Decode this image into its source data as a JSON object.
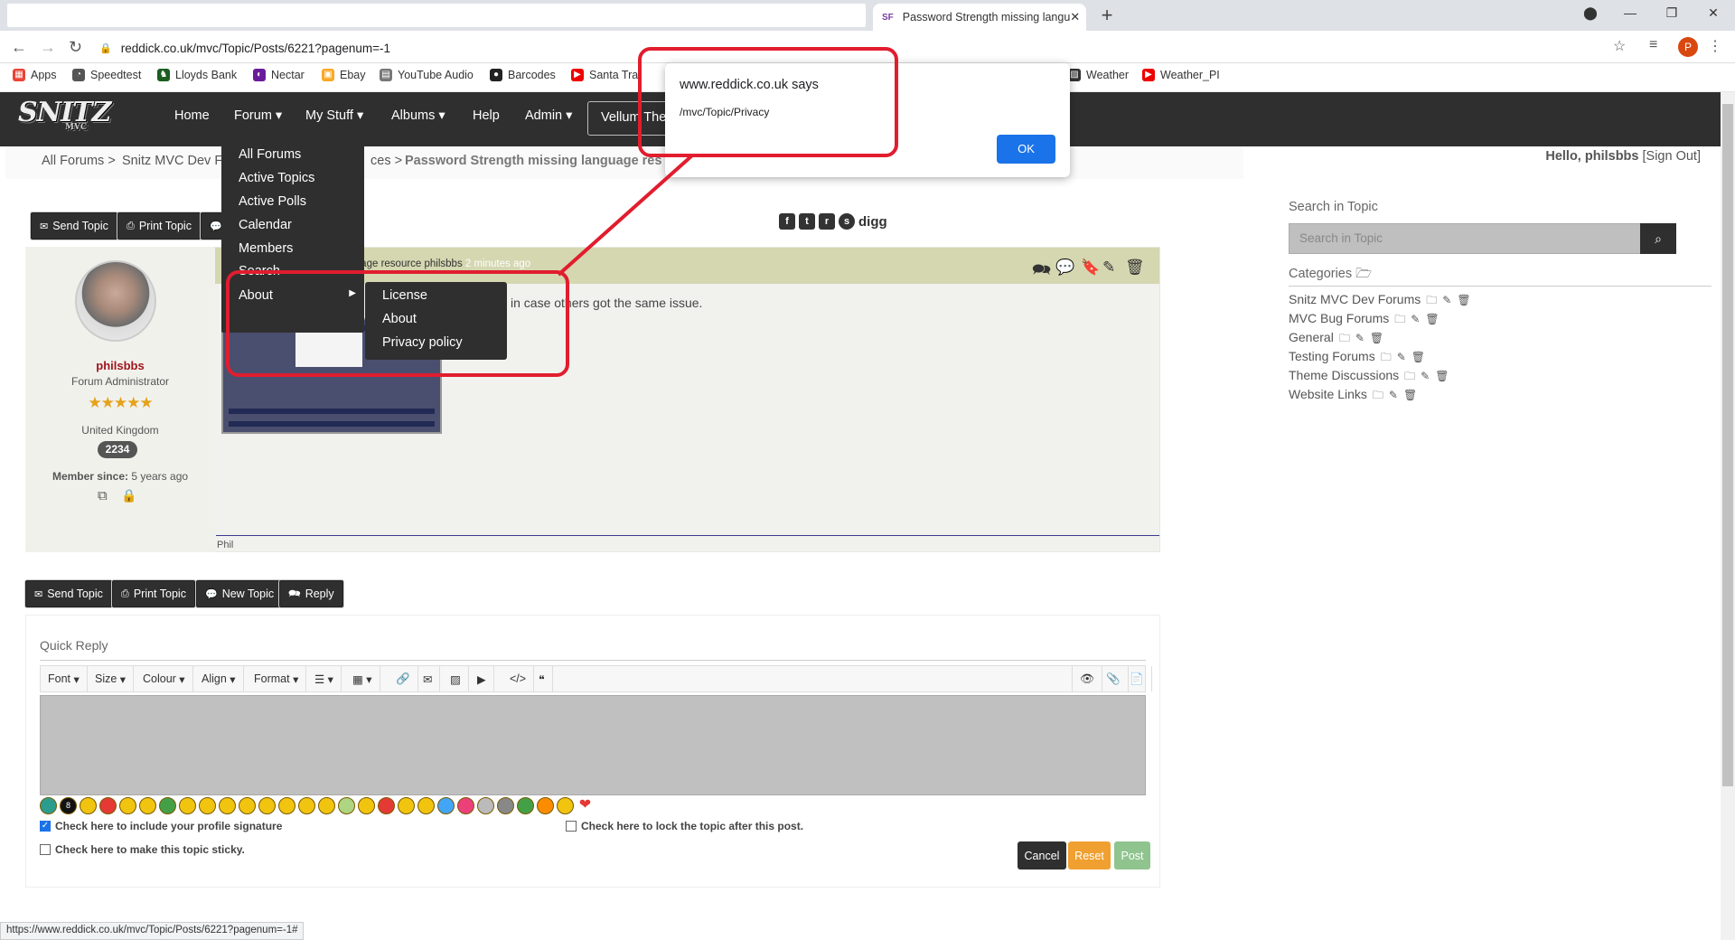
{
  "browser": {
    "tab_title": "Password Strength missing langu",
    "tab_favicon": "SF",
    "url": "reddick.co.uk/mvc/Topic/Posts/6221?pagenum=-1",
    "bookmarks": [
      "Apps",
      "Speedtest",
      "Lloyds Bank",
      "Nectar",
      "Ebay",
      "YouTube Audio",
      "Barcodes",
      "Santa Tra",
      "Weather",
      "Weather_PI"
    ],
    "status_url": "https://www.reddick.co.uk/mvc/Topic/Posts/6221?pagenum=-1#",
    "profile_initial": "P"
  },
  "site": {
    "logo": "SNITZ",
    "logo_sub": "MVC",
    "nav": [
      "Home",
      "Forum",
      "My Stuff",
      "Albums",
      "Help",
      "Admin"
    ],
    "theme_button": "Vellum The",
    "forum_menu": [
      "All Forums",
      "Active Topics",
      "Active Polls",
      "Calendar",
      "Members",
      "Search",
      "About"
    ],
    "about_submenu": [
      "License",
      "About",
      "Privacy policy"
    ]
  },
  "breadcrumb": [
    "All Forums",
    "Snitz MVC Dev Fo",
    "ces",
    "Password Strength missing language res"
  ],
  "greeting": {
    "hello": "Hello, philsbbs",
    "signout": "[Sign Out]"
  },
  "topic_buttons": [
    "Send Topic",
    "Print Topic"
  ],
  "bottom_buttons": [
    "Send Topic",
    "Print Topic",
    "New Topic",
    "Reply"
  ],
  "social": [
    "digg"
  ],
  "post": {
    "header": "nguage resource philsbbs",
    "header_time": "2 minutes ago",
    "text": "in case others got the same issue.",
    "signature": "Phil",
    "author": {
      "name": "philsbbs",
      "role": "Forum Administrator",
      "stars": "★★★★★",
      "country": "United Kingdom",
      "posts": "2234",
      "member_since_label": "Member since:",
      "member_since": "5 years ago"
    }
  },
  "quick_reply": {
    "title": "Quick Reply",
    "toolbar": [
      "Font",
      "Size",
      "Colour",
      "Align",
      "Format"
    ],
    "check_signature": "Check here to include your profile signature",
    "check_lock": "Check here to lock the topic after this post.",
    "check_sticky": "Check here to make this topic sticky.",
    "cancel": "Cancel",
    "reset": "Reset",
    "post": "Post"
  },
  "sidebar": {
    "search_label": "Search in Topic",
    "search_placeholder": "Search in Topic",
    "categories_label": "Categories",
    "categories": [
      "Snitz MVC Dev Forums",
      "MVC Bug Forums",
      "General",
      "Testing Forums",
      "Theme Discussions",
      "Website Links"
    ]
  },
  "alert": {
    "title": "www.reddick.co.uk says",
    "message": "/mvc/Topic/Privacy",
    "ok": "OK"
  },
  "colors": {
    "annotation": "#e11d2e",
    "nav": "#2f2f2f",
    "ok": "#1a73e8",
    "reset": "#f0a030",
    "post": "#8fc48f"
  }
}
